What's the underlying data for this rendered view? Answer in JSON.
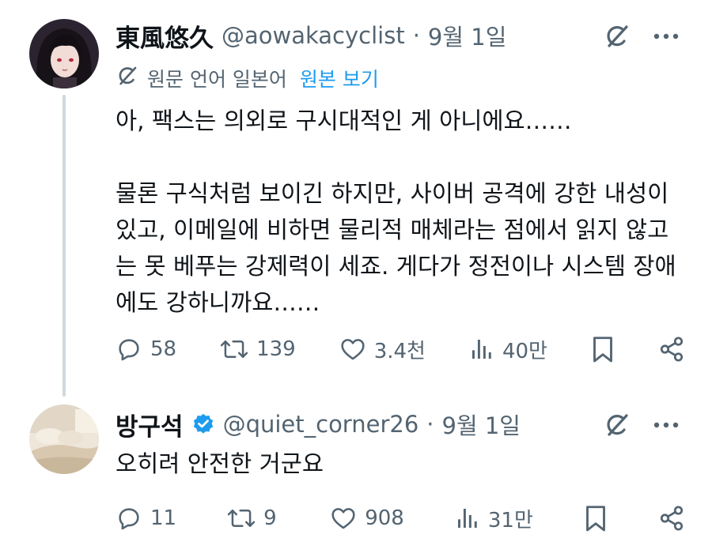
{
  "tweet1": {
    "display_name": "東風悠久",
    "handle": "@aowakacyclist",
    "separator": "·",
    "date": "9월 1일",
    "translate": {
      "label": "원문 언어 일본어",
      "link": "원본 보기"
    },
    "text": "아, 팩스는 의외로 구시대적인 게 아니에요……\n\n물론 구식처럼 보이긴 하지만, 사이버 공격에 강한 내성이 있고, 이메일에 비하면 물리적 매체라는 점에서 읽지 않고는 못 베푸는 강제력이 세죠. 게다가 정전이나 시스템 장애에도 강하니까요……",
    "stats": {
      "replies": "58",
      "reposts": "139",
      "likes": "3.4천",
      "views": "40만"
    }
  },
  "tweet2": {
    "display_name": "방구석",
    "verified": true,
    "handle": "@quiet_corner26",
    "separator": "·",
    "date": "9월 1일",
    "text": "오히려 안전한 거군요",
    "stats": {
      "replies": "11",
      "reposts": "9",
      "likes": "908",
      "views": "31만"
    }
  },
  "colors": {
    "text": "#0f1419",
    "secondary": "#536471",
    "link": "#1d9bf0",
    "verified": "#1d9bf0",
    "thread_line": "#cfd9de"
  },
  "icons": [
    "grok-icon",
    "more-icon",
    "translate-icon",
    "reply-icon",
    "repost-icon",
    "like-icon",
    "views-icon",
    "bookmark-icon",
    "share-icon",
    "verified-badge-icon"
  ]
}
